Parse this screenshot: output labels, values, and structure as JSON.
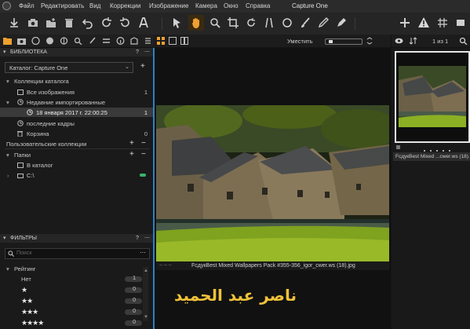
{
  "menu": {
    "items": [
      "Файл",
      "Редактировать",
      "Вид",
      "Коррекции",
      "Изображение",
      "Камера",
      "Окно",
      "Справка"
    ],
    "app_title": "Capture One"
  },
  "viewer_toolbar": {
    "fit_label": "Уместить"
  },
  "browser_toolbar": {
    "count": "1 из 1"
  },
  "library": {
    "title": "БИБЛИОТЕКА",
    "help": "?",
    "catalog_label": "Каталог: Capture One",
    "catalog_collections": "Коллекции каталога",
    "all_images": "Все изображения",
    "all_images_count": "1",
    "recent_imports": "Недавние импортированные",
    "import_date": "18 января 2017 г. 22:00:25",
    "import_count": "1",
    "recent_captures": "последние кадры",
    "trash": "Корзина",
    "trash_count": "0",
    "user_collections": "Пользовательские коллекции",
    "folders": "Папки",
    "in_catalog": "В каталог",
    "drive": "C:\\"
  },
  "filters": {
    "title": "ФИЛЬТРЫ",
    "help": "?",
    "search_placeholder": "Поиск",
    "rating_label": "Рейтинг",
    "rows": [
      {
        "label": "Нет",
        "count": "1"
      },
      {
        "label": "★",
        "count": "0"
      },
      {
        "label": "★★",
        "count": "0"
      },
      {
        "label": "★★★",
        "count": "0"
      },
      {
        "label": "★★★★",
        "count": "0"
      }
    ]
  },
  "viewer": {
    "caption": "FcдукBest Mixed Wallpapers Pack #355-356_igor_cwer.ws (18).jpg",
    "watermark": "ناصر عبد الحميد"
  },
  "browser": {
    "thumb_caption": "FcдукBest Mixed ...cwer.ws (18)..."
  },
  "colors": {
    "accent": "#2a83c8",
    "orange": "#f0a030",
    "watermark": "#f1c23a",
    "green_tag": "#3ab56a"
  }
}
